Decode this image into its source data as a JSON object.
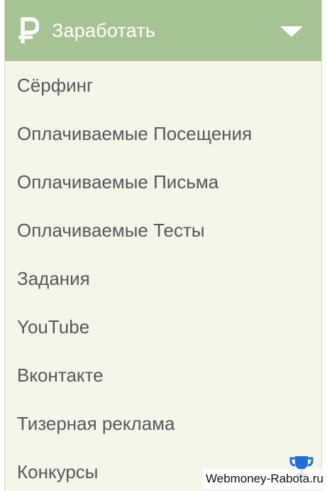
{
  "menu": {
    "header_label": "Заработать",
    "header_icon": "ruble-icon",
    "toggle_icon": "chevron-down-icon",
    "items": [
      {
        "label": "Сёрфинг"
      },
      {
        "label": "Оплачиваемые Посещения"
      },
      {
        "label": "Оплачиваемые Письма"
      },
      {
        "label": "Оплачиваемые Тесты"
      },
      {
        "label": "Задания"
      },
      {
        "label": "YouTube"
      },
      {
        "label": "Вконтакте"
      },
      {
        "label": "Тизерная реклама"
      },
      {
        "label": "Конкурсы"
      }
    ]
  },
  "watermark": {
    "text": "Webmoney-Rabota.ru",
    "icon": "trophy-icon"
  },
  "colors": {
    "header_bg": "#a8c393",
    "panel_bg": "#f3f7ea",
    "item_text": "#55585a",
    "trophy": "#1f6fd6"
  }
}
